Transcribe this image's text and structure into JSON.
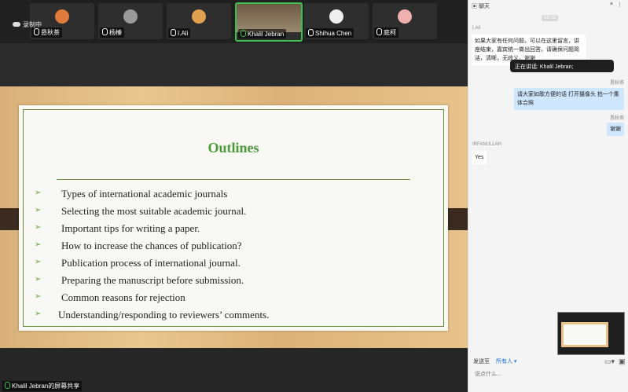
{
  "recording": "录制中",
  "participants": [
    {
      "name": "恳秋茶",
      "color": "#e07a3a"
    },
    {
      "name": "杨榛",
      "color": "#9a9a9a"
    },
    {
      "name": "I.Ali",
      "color": "#e0a050"
    },
    {
      "name": "Khalil Jebran",
      "color": "#8a7a60"
    },
    {
      "name": "Shihua Chen",
      "color": "#eeeeee"
    },
    {
      "name": "庭柯",
      "color": "#f0b0b0"
    }
  ],
  "slide": {
    "title": "Outlines",
    "bullets": [
      "Types of international academic journals",
      "Selecting the most suitable academic journal.",
      "Important tips for writing a paper.",
      "How to increase the chances of publication?",
      "Publication process of international journal.",
      "Preparing the manuscript before submission.",
      "Common reasons for rejection",
      "Understanding/responding to reviewers’ comments."
    ]
  },
  "screen_share_label": "Khalil Jebran的屏幕共享",
  "chat": {
    "title": "聊天",
    "timestamp": "18:33",
    "messages": [
      {
        "sender": "I.Ali",
        "text": "如果大家有任何问题，可以在这里留言，讲座结束，嘉宾统一做出回答。请确保问题简洁，清晰，无歧义。谢谢",
        "side": "left"
      },
      {
        "sender": "恳秋茶",
        "text": "请大家如歌方便的话 打开摄像头 拍一个集体合照",
        "side": "right"
      },
      {
        "sender": "恳秋茶",
        "text": "谢谢",
        "side": "right"
      },
      {
        "sender": "IRFANULLAH",
        "text": "Yes",
        "side": "left"
      }
    ],
    "speaking": "正在讲话: Khalil Jebran;",
    "send_to_label": "发送至",
    "send_to_value": "所有人",
    "input_placeholder": "说点什么..."
  },
  "colors": {
    "accent_green": "#3fbf50",
    "slide_title": "#4a9a3a",
    "chat_bubble_right": "#cfe6ff"
  }
}
